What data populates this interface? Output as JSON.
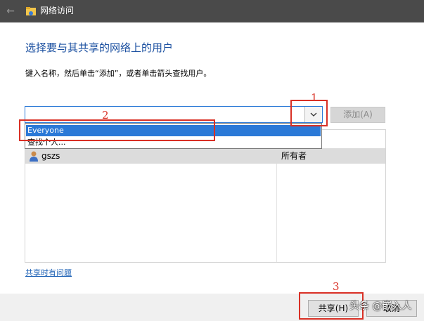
{
  "window": {
    "title": "网络访问"
  },
  "dialog": {
    "heading": "选择要与其共享的网络上的用户",
    "instruction": "键入名称，然后单击“添加”，或者单击箭头查找用户。",
    "input": {
      "value": "",
      "placeholder": ""
    },
    "add_button": "添加(A)",
    "dropdown": {
      "options": [
        "Everyone",
        "查找个人..."
      ],
      "selected": "Everyone"
    },
    "users": [
      {
        "name": "gszs",
        "level": "所有者"
      }
    ],
    "help_link": "共享时有问题",
    "share_button": "共享(H)",
    "cancel_button": "取消"
  },
  "annotations": {
    "labels": [
      "1",
      "2",
      "3"
    ],
    "color": "#d93025"
  },
  "watermark": "头条 @嵌入人"
}
